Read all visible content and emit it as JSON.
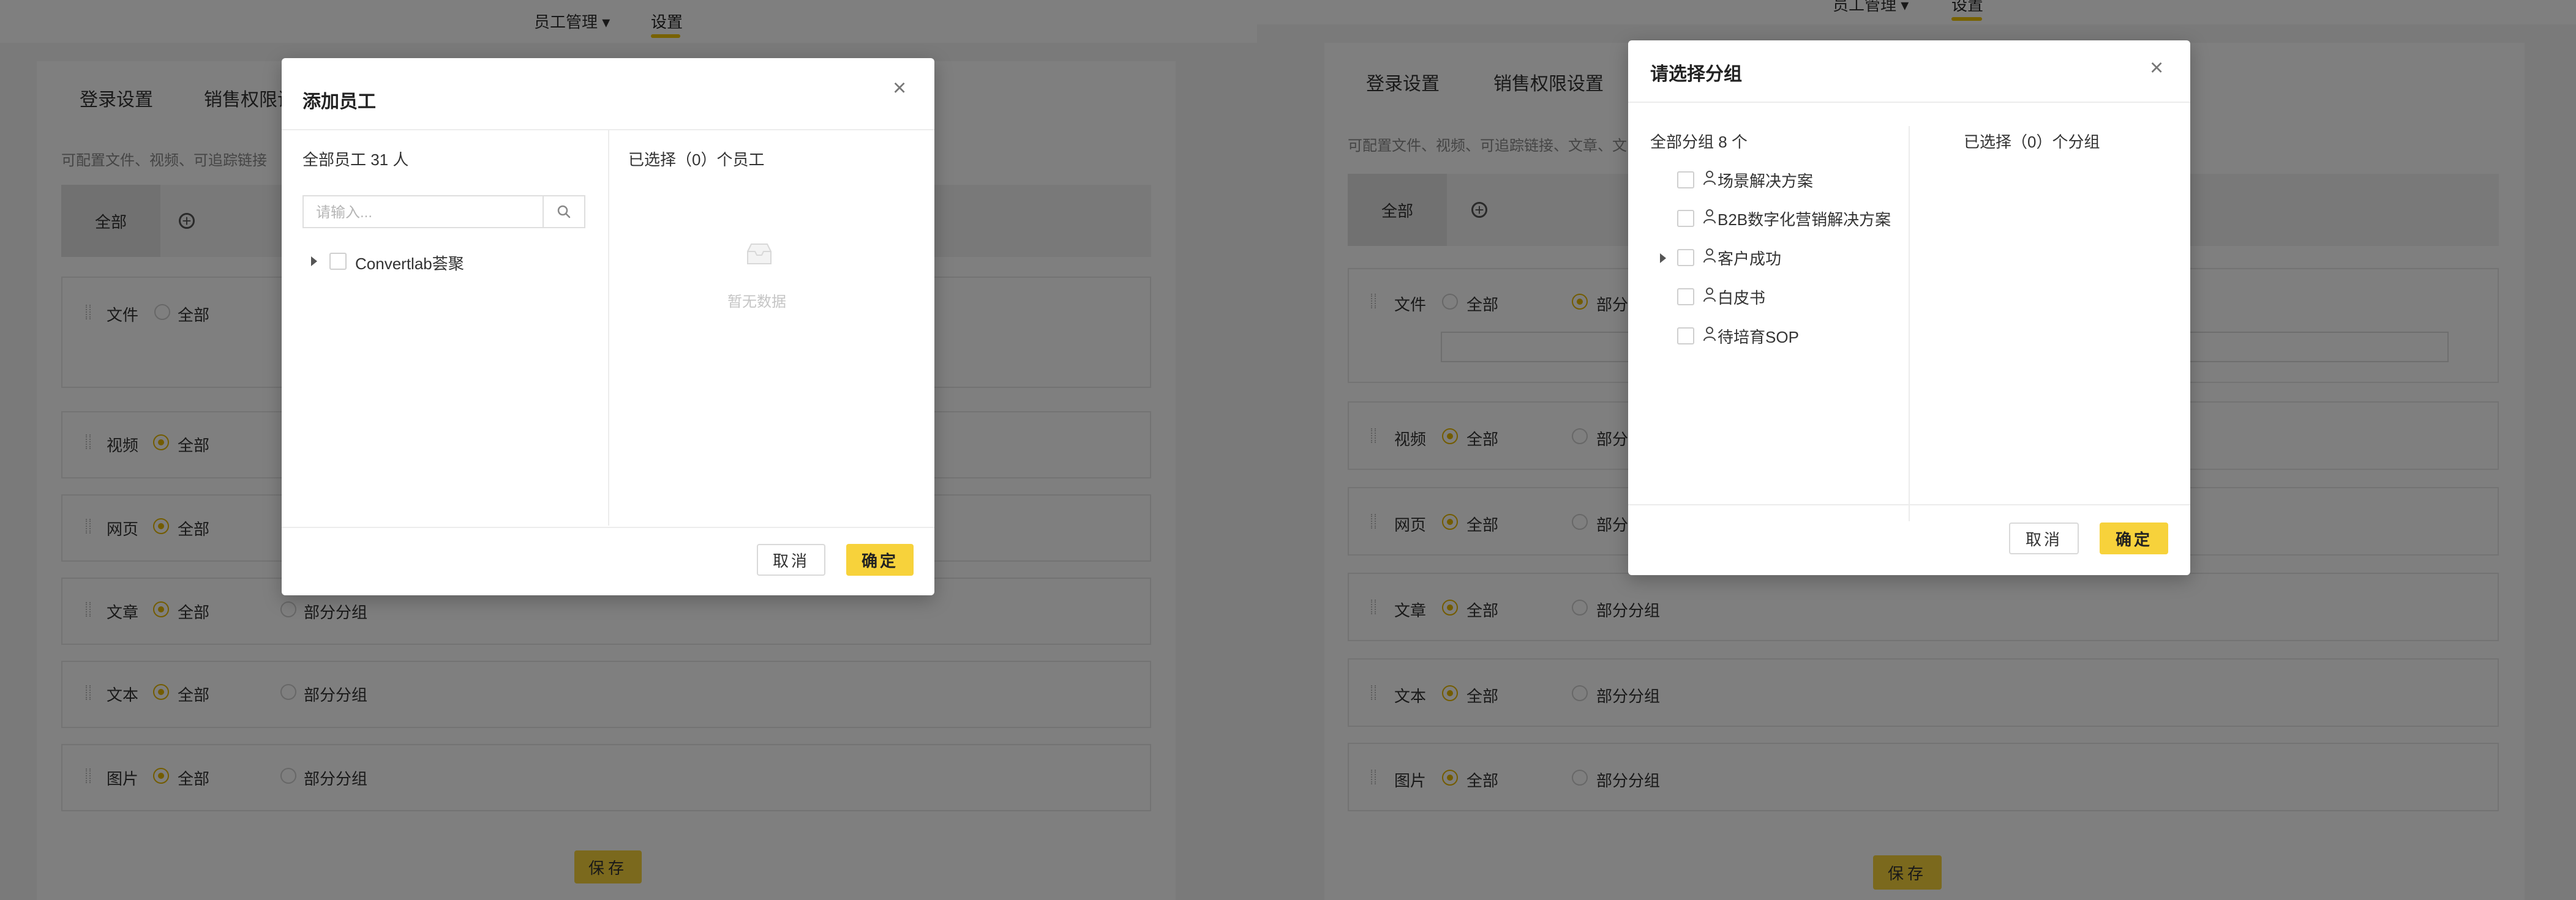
{
  "left_screen": {
    "nav": {
      "staff_menu": "员工管理",
      "settings": "设置"
    },
    "tabs": [
      "登录设置",
      "销售权限设"
    ],
    "description": "可配置文件、视频、可追踪链接",
    "category_all": "全部",
    "rows": [
      {
        "label": "文件",
        "option_all": "全部",
        "option_partial": ""
      },
      {
        "label": "视频",
        "option_all": "全部",
        "option_partial": ""
      },
      {
        "label": "网页",
        "option_all": "全部",
        "option_partial": ""
      },
      {
        "label": "文章",
        "option_all": "全部",
        "option_partial": "部分分组"
      },
      {
        "label": "文本",
        "option_all": "全部",
        "option_partial": "部分分组"
      },
      {
        "label": "图片",
        "option_all": "全部",
        "option_partial": "部分分组"
      }
    ],
    "save_button": "保存",
    "modal": {
      "title": "添加员工",
      "all_count": "全部员工 31 人",
      "selected": "已选择（0）个员工",
      "search_placeholder": "请输入...",
      "tree_root": "Convertlab荟聚",
      "empty_text": "暂无数据",
      "cancel": "取消",
      "ok": "确定"
    }
  },
  "right_screen": {
    "nav": {
      "staff_menu": "员工管理",
      "settings": "设置"
    },
    "tabs": [
      "登录设置",
      "销售权限设置"
    ],
    "description": "可配置文件、视频、可追踪链接、文章、文",
    "category_all": "全部",
    "rows": [
      {
        "label": "文件",
        "option_all": "全部",
        "option_partial": "部分"
      },
      {
        "label": "视频",
        "option_all": "全部",
        "option_partial": "部分"
      },
      {
        "label": "网页",
        "option_all": "全部",
        "option_partial": "部分"
      },
      {
        "label": "文章",
        "option_all": "全部",
        "option_partial": "部分分组"
      },
      {
        "label": "文本",
        "option_all": "全部",
        "option_partial": "部分分组"
      },
      {
        "label": "图片",
        "option_all": "全部",
        "option_partial": "部分分组"
      }
    ],
    "save_button": "保存",
    "modal": {
      "title": "请选择分组",
      "all_count": "全部分组 8 个",
      "selected": "已选择（0）个分组",
      "groups": [
        "场景解决方案",
        "B2B数字化营销解决方案",
        "客户成功",
        "白皮书",
        "待培育SOP"
      ],
      "cancel": "取消",
      "ok": "确定"
    }
  },
  "colors": {
    "accent": "#f7d23b",
    "radio_selected": "#e6b800",
    "overlay": "rgba(0,0,0,0.5)"
  }
}
